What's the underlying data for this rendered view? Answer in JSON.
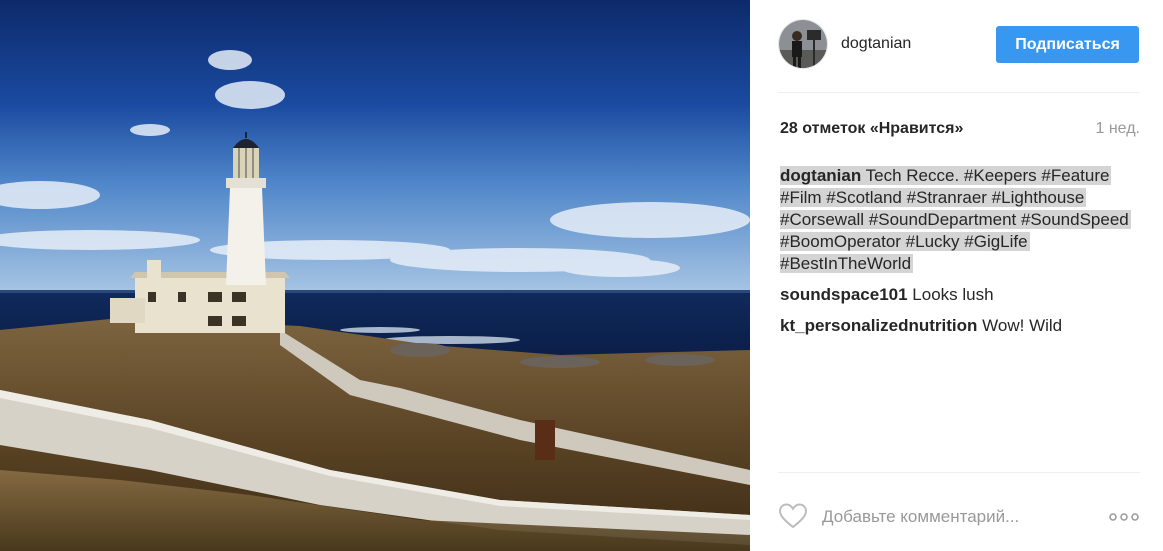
{
  "photo": {
    "description_icon": "lighthouse-photo"
  },
  "header": {
    "username": "dogtanian",
    "follow_label": "Подписаться"
  },
  "stats": {
    "likes": "28 отметок «Нравится»",
    "time": "1 нед."
  },
  "caption": {
    "user": "dogtanian",
    "text": "Tech Recce. #Keepers #Feature #Film #Scotland #Stranraer #Lighthouse #Corsewall #SoundDepartment #SoundSpeed #BoomOperator #Lucky #GigLife #BestInTheWorld"
  },
  "comments": [
    {
      "user": "soundspace101",
      "text": "Looks lush"
    },
    {
      "user": "kt_personalizednutrition",
      "text": "Wow! Wild"
    }
  ],
  "add_comment": {
    "placeholder": "Добавьте комментарий..."
  },
  "colors": {
    "follow_button": "#3897f0",
    "divider": "#efefef",
    "muted_text": "#999999",
    "caption_highlight": "#d4d4d4"
  },
  "icons": {
    "like": "heart-icon",
    "more": "ellipsis-icon"
  }
}
